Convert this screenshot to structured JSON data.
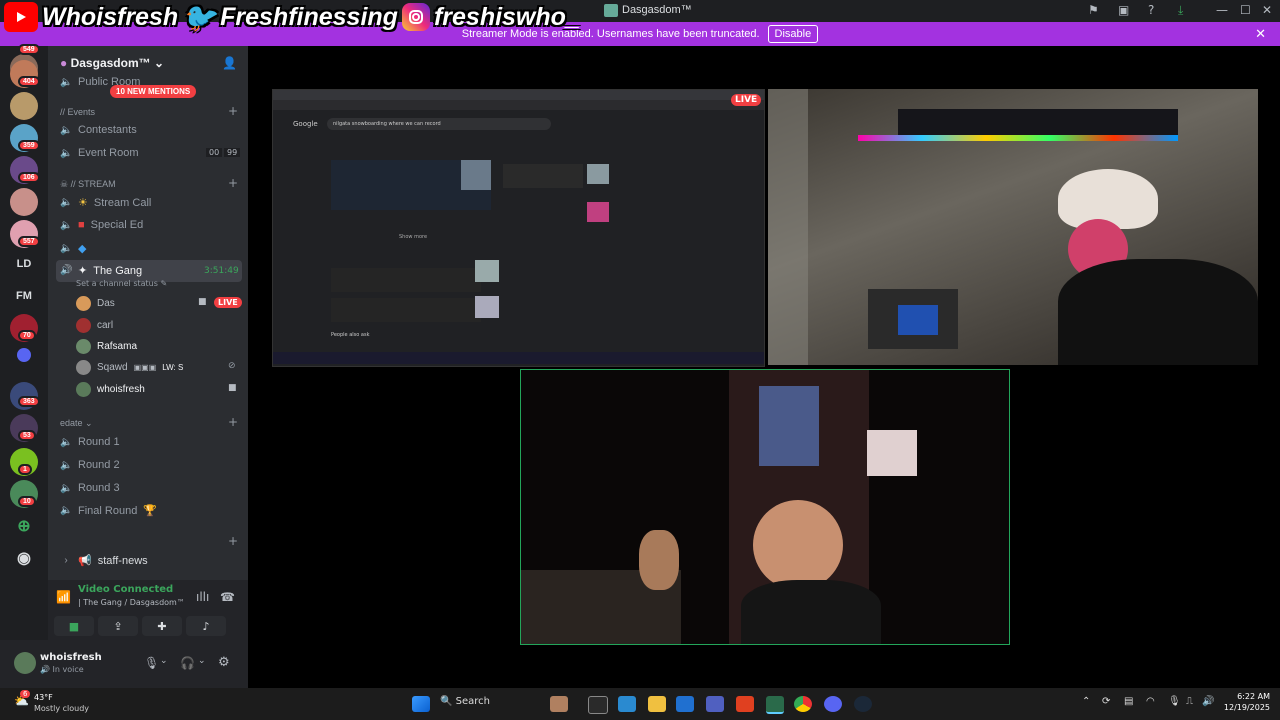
{
  "social": {
    "youtube": "Whoisfresh",
    "twitter": "Freshfinessing",
    "instagram": "freshiswho_"
  },
  "window": {
    "title": "Dasgasdom™"
  },
  "streamer_bar": {
    "message": "Streamer Mode is enabled. Usernames have been truncated.",
    "disable_label": "Disable"
  },
  "rail": {
    "badges": [
      "549",
      "404",
      "359",
      "106",
      "557",
      "70",
      "363",
      "53",
      "1",
      "10"
    ],
    "text_items": [
      "LD",
      "FM"
    ]
  },
  "sidebar": {
    "server_name": "Dasgasdom™",
    "new_mentions": "10 NEW MENTIONS",
    "partial_channel": "Public Room",
    "events_category": "// Events",
    "contestants": "Contestants",
    "event_room": "Event Room",
    "event_room_counts": [
      "00",
      "99"
    ],
    "stream_category": "// STREAM",
    "stream_call": "Stream Call",
    "special_ed": "Special Ed",
    "the_gang": "The Gang",
    "the_gang_timer": "3:51:49",
    "channel_status": "Set a channel status",
    "users": [
      {
        "name": "Das",
        "live": "LIVE"
      },
      {
        "name": "carl"
      },
      {
        "name": "Rafsama"
      },
      {
        "name": "Sqawd",
        "extra": "LW: S"
      },
      {
        "name": "whoisfresh"
      }
    ],
    "edate_category": "edate",
    "rounds": [
      "Round 1",
      "Round 2",
      "Round 3",
      "Final Round"
    ],
    "staff_news": "staff-news"
  },
  "voice": {
    "status": "Video Connected",
    "location": "The Gang / Dasgasdom™"
  },
  "user_panel": {
    "name": "whoisfresh",
    "status": "In voice"
  },
  "screen_share": {
    "search_query": "nilgata snowboarding where we can record",
    "live_label": "LIVE",
    "show_more": "Show more",
    "people_also_ask": "People also ask"
  },
  "taskbar": {
    "weather_temp": "43°F",
    "weather_desc": "Mostly cloudy",
    "search_label": "Search",
    "time": "6:22 AM",
    "date": "12/19/2025"
  }
}
